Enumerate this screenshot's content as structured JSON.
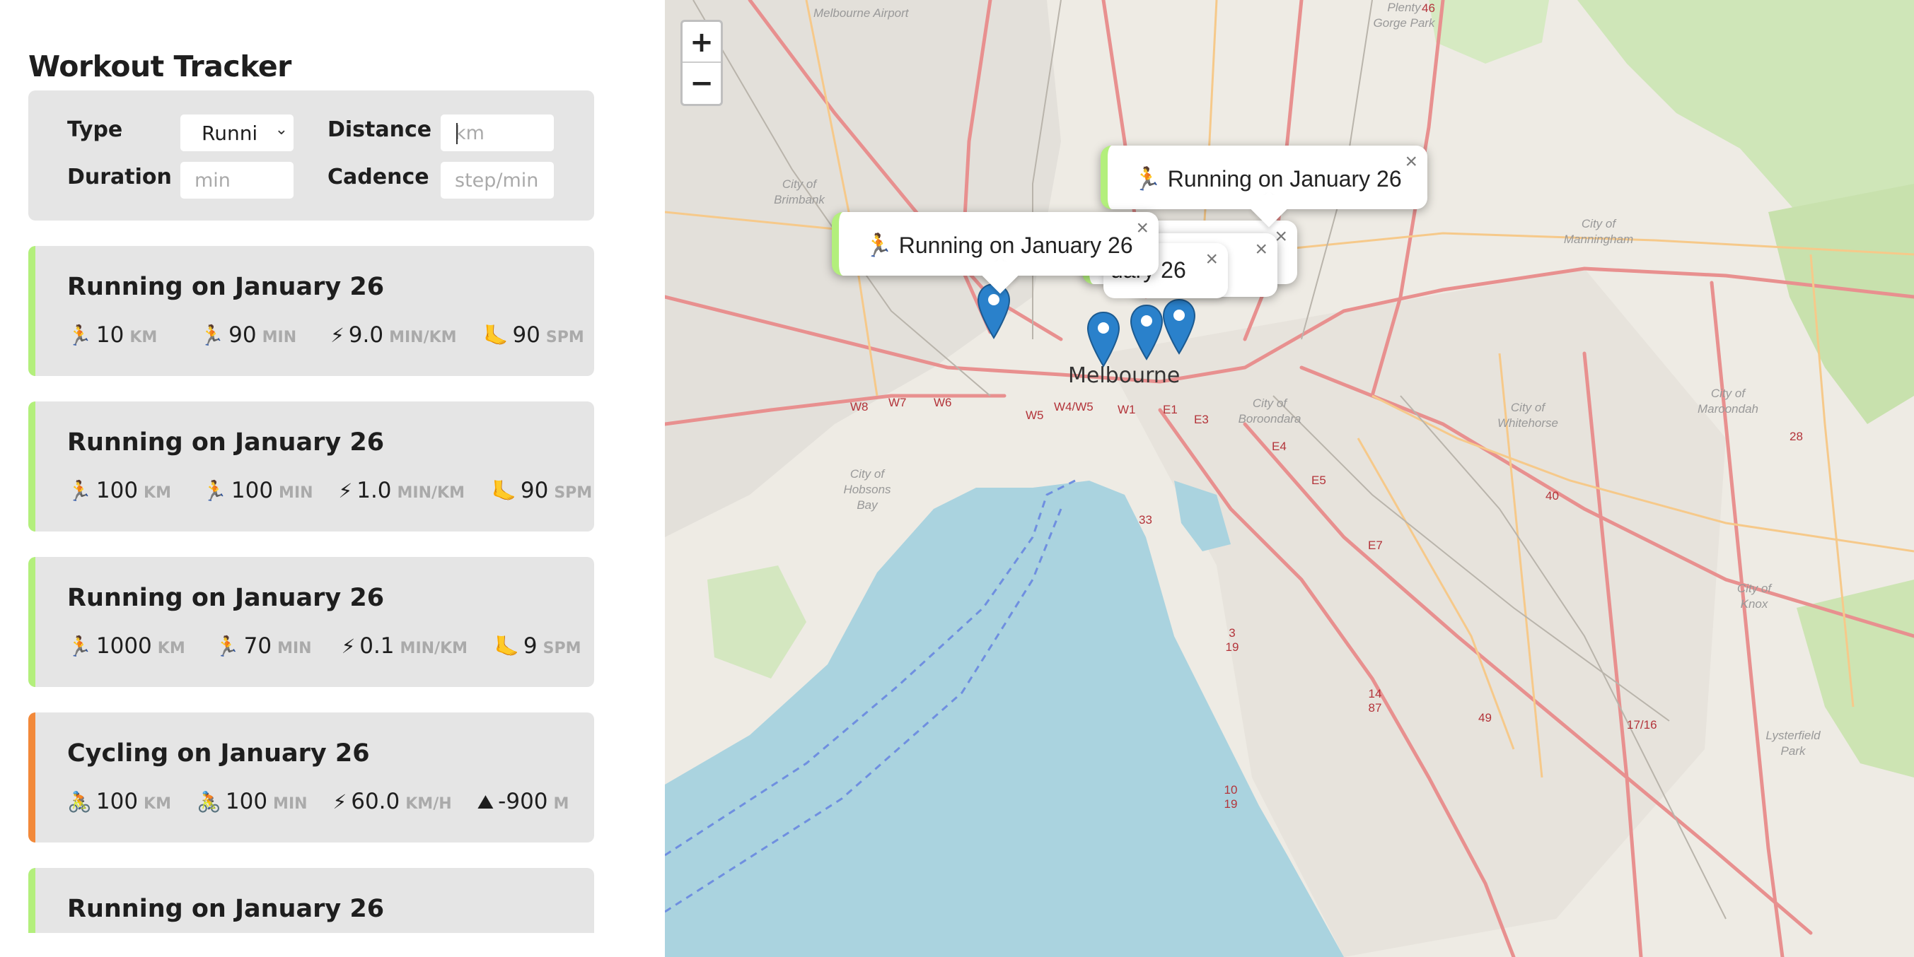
{
  "app": {
    "title": "Workout Tracker"
  },
  "form": {
    "type_label": "Type",
    "type_value": "Runni",
    "distance_label": "Distance",
    "distance_placeholder": "km",
    "duration_label": "Duration",
    "duration_placeholder": "min",
    "cadence_label": "Cadence",
    "cadence_placeholder": "step/min"
  },
  "workouts": [
    {
      "type": "running",
      "title": "Running on January 26",
      "details": [
        {
          "icon": "🏃",
          "value": "10",
          "unit": "KM"
        },
        {
          "icon": "🏃",
          "value": "90",
          "unit": "MIN"
        },
        {
          "icon": "⚡",
          "value": "9.0",
          "unit": "MIN/KM"
        },
        {
          "icon": "🦶",
          "value": "90",
          "unit": "SPM"
        }
      ]
    },
    {
      "type": "running",
      "title": "Running on January 26",
      "details": [
        {
          "icon": "🏃",
          "value": "100",
          "unit": "KM"
        },
        {
          "icon": "🏃",
          "value": "100",
          "unit": "MIN"
        },
        {
          "icon": "⚡",
          "value": "1.0",
          "unit": "MIN/KM"
        },
        {
          "icon": "🦶",
          "value": "90",
          "unit": "SPM"
        }
      ]
    },
    {
      "type": "running",
      "title": "Running on January 26",
      "details": [
        {
          "icon": "🏃",
          "value": "1000",
          "unit": "KM"
        },
        {
          "icon": "🏃",
          "value": "70",
          "unit": "MIN"
        },
        {
          "icon": "⚡",
          "value": "0.1",
          "unit": "MIN/KM"
        },
        {
          "icon": "🦶",
          "value": "9",
          "unit": "SPM"
        }
      ]
    },
    {
      "type": "cycling",
      "title": "Cycling on January 26",
      "details": [
        {
          "icon": "🚴",
          "value": "100",
          "unit": "KM"
        },
        {
          "icon": "🚴",
          "value": "100",
          "unit": "MIN"
        },
        {
          "icon": "⚡",
          "value": "60.0",
          "unit": "KM/H"
        },
        {
          "icon": "⛰",
          "value": "-900",
          "unit": "M"
        }
      ]
    },
    {
      "type": "running",
      "title": "Running on January 26",
      "details": []
    }
  ],
  "map": {
    "zoom_in": "+",
    "zoom_out": "−",
    "city": "Melbourne",
    "places": [
      "Melbourne Airport",
      "City of Brimbank",
      "City of Manningham",
      "City of Boroondara",
      "City of Whitehorse",
      "City of Maroondah",
      "City of Hobsons Bay",
      "City of Knox",
      "Lysterfield Park",
      "Plenty Gorge Park"
    ],
    "road_numbers": [
      "46",
      "40",
      "28",
      "33",
      "49",
      "3 19",
      "14 87",
      "10 19",
      "17/16",
      "W8",
      "W7",
      "W6",
      "W5",
      "W4/W5",
      "W1",
      "E1",
      "E3",
      "E4",
      "E5",
      "E7"
    ],
    "popups": [
      {
        "text": "🏃 Running on January 26",
        "close": "×"
      },
      {
        "text": "🏃 Running on January 26",
        "close": "×"
      },
      {
        "text": "🏃 Running on January 26",
        "close": "×"
      },
      {
        "text": "🏃 Running on January 26",
        "close": "×"
      }
    ],
    "popup_partial_text": "uary 26",
    "marker_color": "#2a81cb",
    "water_color": "#aad3df",
    "running_color": "#b3ef7c",
    "cycling_color": "#f2893a"
  }
}
